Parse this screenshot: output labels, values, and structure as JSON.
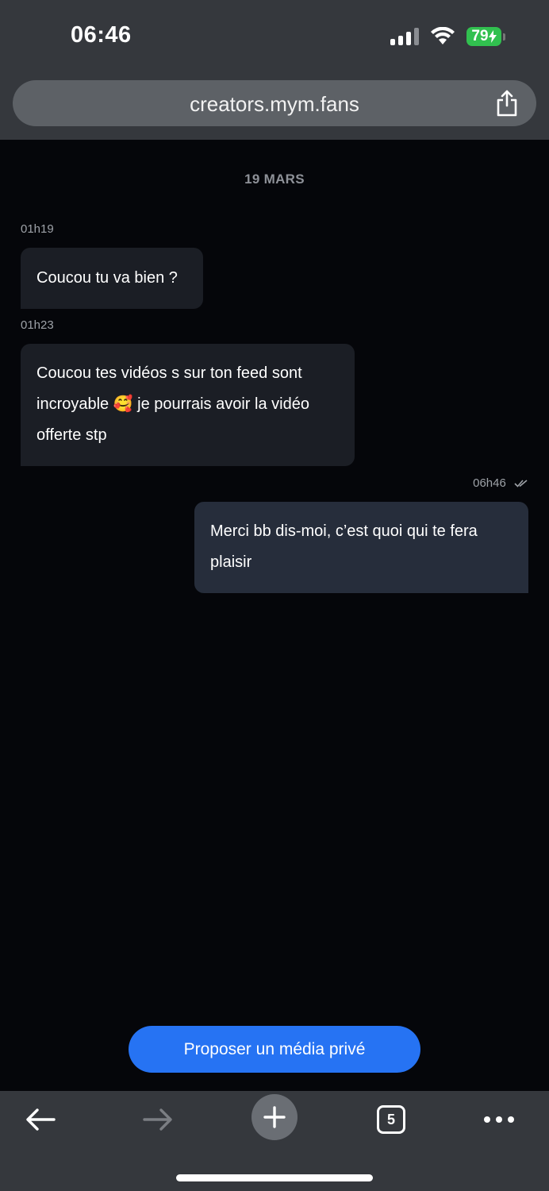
{
  "status_bar": {
    "time": "06:46",
    "battery": "79"
  },
  "browser": {
    "url": "creators.mym.fans",
    "tab_count": "5"
  },
  "chat": {
    "date": "19 MARS",
    "messages": [
      {
        "time": "01h19",
        "text": "Coucou tu va bien ?",
        "direction": "incoming"
      },
      {
        "time": "01h23",
        "lines": [
          "Coucou tes vidéos s sur ton feed sont",
          "incroyable 🥰 je pourrais avoir la vidéo",
          "offerte stp"
        ],
        "direction": "incoming"
      },
      {
        "time": "06h46",
        "lines": [
          "Merci bb dis-moi, c’est quoi qui te fera",
          "plaisir"
        ],
        "direction": "outgoing",
        "read": true
      }
    ]
  },
  "actions": {
    "propose_label": "Proposer un média privé"
  },
  "colors": {
    "accent": "#2673f3",
    "battery": "#31c04f",
    "incoming_bubble": "#1b1e25",
    "outgoing_bubble": "#262d3b"
  },
  "icons": [
    "signal-icon",
    "wifi-icon",
    "battery-icon",
    "share-icon",
    "read-ticks-icon",
    "back-arrow-icon",
    "forward-arrow-icon",
    "plus-icon",
    "tabs-icon",
    "more-icon"
  ]
}
